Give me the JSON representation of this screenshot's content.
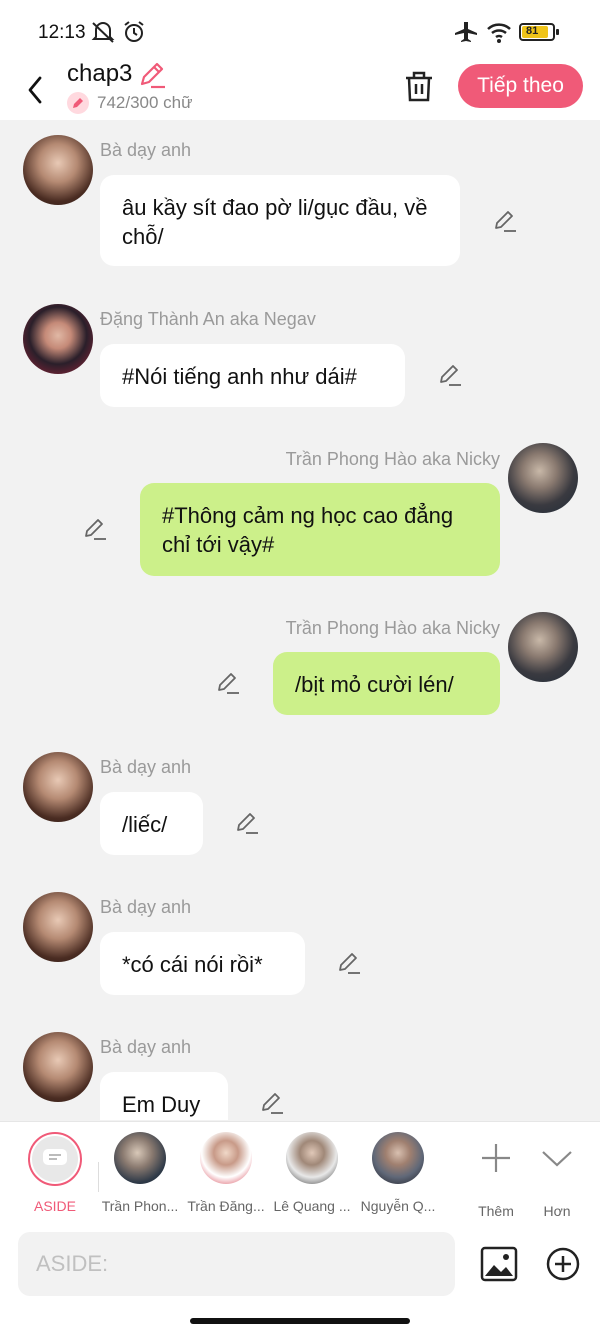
{
  "status": {
    "time": "12:13",
    "battery": "81"
  },
  "header": {
    "title": "chap3",
    "word_count": "742/300 chữ",
    "next_label": "Tiếp theo"
  },
  "messages": [
    {
      "name": "Bà dạy anh",
      "text": "âu kầy sít đao pờ li/gục đầu, về chỗ/"
    },
    {
      "name": "Đặng Thành An aka Negav",
      "text": "#Nói tiếng anh như dái#"
    },
    {
      "name": "Trần Phong Hào aka Nicky",
      "text": "#Thông cảm ng học cao đẳng chỉ tới vậy#"
    },
    {
      "name": "Trần Phong Hào aka Nicky",
      "text": "/bịt mỏ cười lén/"
    },
    {
      "name": "Bà dạy anh",
      "text": "/liếc/"
    },
    {
      "name": "Bà dạy anh",
      "text": "*có cái nói rồi*"
    },
    {
      "name": "Bà dạy anh",
      "text": "Em Duy"
    }
  ],
  "cast": [
    {
      "label": "ASIDE"
    },
    {
      "label": "Trần Phon..."
    },
    {
      "label": "Trần Đăng..."
    },
    {
      "label": "Lê Quang ..."
    },
    {
      "label": "Nguyễn Q..."
    },
    {
      "label": "Thêm"
    },
    {
      "label": "Hơn"
    }
  ],
  "input": {
    "placeholder": "ASIDE:"
  },
  "colors": {
    "accent": "#f05a78",
    "bubble_green": "#ccf08a",
    "bubble_white": "#ffffff"
  }
}
